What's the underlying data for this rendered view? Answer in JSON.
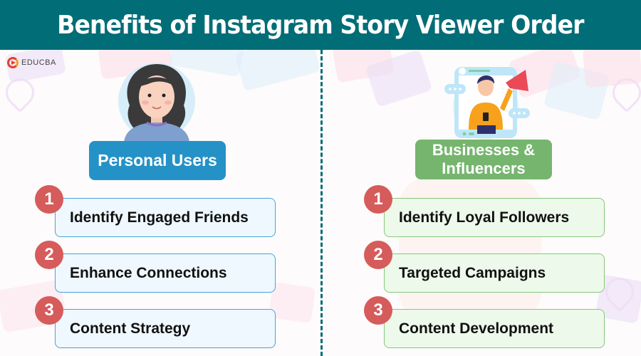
{
  "title": "Benefits of Instagram Story Viewer Order",
  "brand": {
    "logo_text": "EDUCBA"
  },
  "colors": {
    "header_bg": "#006d77",
    "personal_accent": "#2492c7",
    "business_accent": "#76b56e",
    "number_badge": "#d65b5b"
  },
  "columns": [
    {
      "heading": "Personal Users",
      "illustration": "woman-avatar",
      "items": [
        {
          "number": "1",
          "label": "Identify Engaged Friends"
        },
        {
          "number": "2",
          "label": "Enhance Connections"
        },
        {
          "number": "3",
          "label": "Content Strategy"
        }
      ]
    },
    {
      "heading_line1": "Businesses &",
      "heading_line2": "Influencers",
      "illustration": "man-with-megaphone",
      "items": [
        {
          "number": "1",
          "label": "Identify Loyal Followers"
        },
        {
          "number": "2",
          "label": "Targeted Campaigns"
        },
        {
          "number": "3",
          "label": "Content Development"
        }
      ]
    }
  ]
}
